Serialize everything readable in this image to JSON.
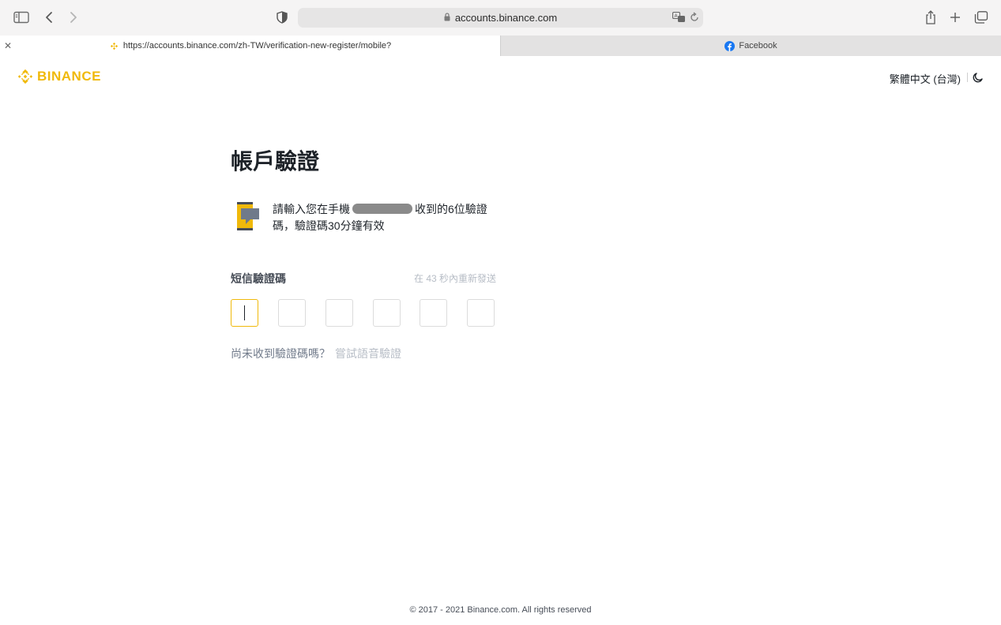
{
  "browser": {
    "address_text": "accounts.binance.com",
    "tabs": [
      {
        "title": "https://accounts.binance.com/zh-TW/verification-new-register/mobile?",
        "active": true
      },
      {
        "title": "Facebook",
        "active": false
      }
    ]
  },
  "header": {
    "logo_text": "BINANCE",
    "language": "繁體中文 (台灣)"
  },
  "main": {
    "title": "帳戶驗證",
    "message_part1": "請輸入您在手機",
    "message_part2": "收到的6位驗證碼，驗證碼30分鐘有效",
    "code_label": "短信驗證碼",
    "resend_text": "在 43 秒內重新發送",
    "code_boxes": [
      "",
      "",
      "",
      "",
      "",
      ""
    ],
    "no_receive_text": "尚未收到驗證碼嗎？",
    "voice_link": "嘗試語音驗證"
  },
  "footer": {
    "copyright": "© 2017 - 2021 Binance.com. All rights reserved"
  },
  "colors": {
    "brand": "#f0b90b",
    "text": "#1e2329",
    "muted": "#b7bdc6"
  }
}
